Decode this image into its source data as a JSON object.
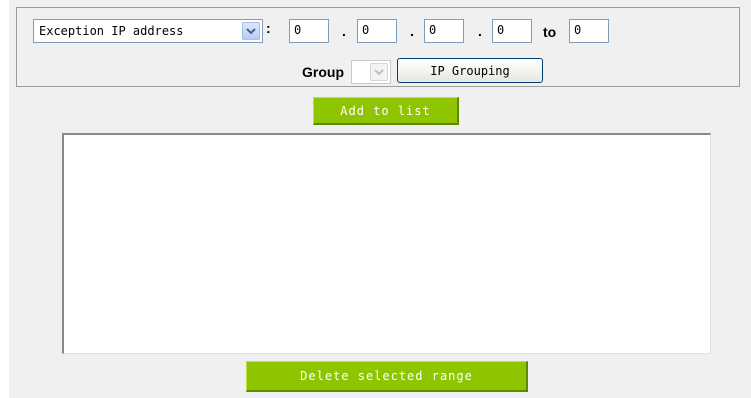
{
  "range": {
    "type_select_value": "Exception IP address",
    "colon": ":",
    "ip_octets": [
      "0",
      "0",
      "0",
      "0"
    ],
    "dot": ".",
    "to_label": "to",
    "to_value": "0"
  },
  "group": {
    "label": "Group",
    "select_value": "",
    "ip_grouping_label": "IP Grouping"
  },
  "actions": {
    "add_label": "Add to list",
    "delete_label": "Delete selected range"
  },
  "list": {
    "items": []
  },
  "icons": {
    "type_select_arrow": "chevron-down-icon",
    "group_select_arrow": "chevron-down-icon"
  },
  "colors": {
    "accent_green": "#8ec400",
    "panel_bg": "#f0f0f0"
  }
}
